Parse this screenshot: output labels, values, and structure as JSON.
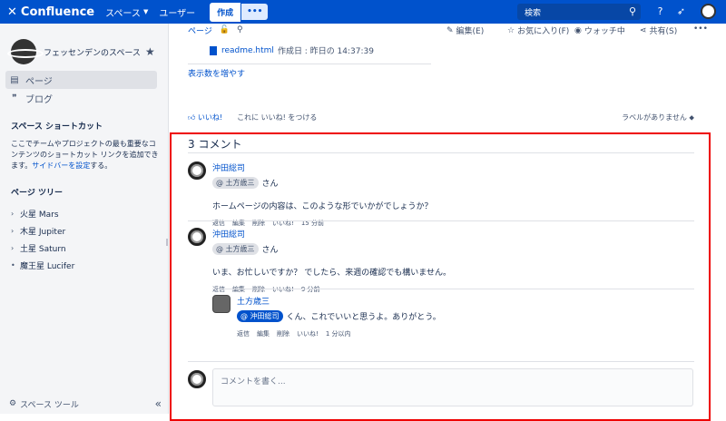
{
  "topnav": {
    "logo": "Confluence",
    "spaces": "スペース",
    "people": "ユーザー",
    "create": "作成",
    "more": "•••",
    "search_placeholder": "検索",
    "search_icon": "search-icon",
    "help_icon": "help-icon",
    "notifications_icon": "rocket-icon"
  },
  "sidebar": {
    "space_name": "フェッセンデンのスペース",
    "items": [
      {
        "label": "ページ",
        "icon": "page-icon"
      },
      {
        "label": "ブログ",
        "icon": "quote-icon"
      }
    ],
    "shortcuts_heading": "スペース ショートカット",
    "shortcuts_text": "ここでチームやプロジェクトの最も重要なコンテンツのショートカット リンクを追加できます。",
    "shortcuts_link": "サイドバーを設定",
    "shortcuts_tail": "する。",
    "tree_heading": "ページ ツリー",
    "tree": [
      {
        "label": "火星 Mars",
        "mark": "›"
      },
      {
        "label": "木星 Jupiter",
        "mark": "›"
      },
      {
        "label": "土星 Saturn",
        "mark": "›"
      },
      {
        "label": "魔王星 Lucifer",
        "mark": "•"
      }
    ],
    "footer": "スペース ツール",
    "collapse": "«"
  },
  "page": {
    "breadcrumb": "ページ",
    "actions": {
      "edit": "編集(E)",
      "favorite": "お気に入り(F)",
      "watch": "ウォッチ中",
      "share": "共有(S)",
      "more": "•••"
    },
    "attachment": "readme.html",
    "attachment_meta": "作成日 : 昨日の 14:37:39",
    "show_more": "表示数を増やす",
    "like": "いいね!",
    "like_prompt": "これに いいね! をつける",
    "labels": "ラベルがありません"
  },
  "comments": {
    "title": "3 コメント",
    "items": [
      {
        "author": "沖田総司",
        "mention": "@ 土方歳三",
        "mention_suffix": "さん",
        "text": "ホームページの内容は、このような形でいかがでしょうか？",
        "actions": [
          "返信",
          "編集",
          "削除",
          "いいね!",
          "15 分前"
        ]
      },
      {
        "author": "沖田総司",
        "mention": "@ 土方歳三",
        "mention_suffix": "さん",
        "text": "いま、お忙しいですか？ でしたら、来週の確認でも構いません。",
        "actions": [
          "返信",
          "編集",
          "削除",
          "いいね!",
          "9 分前"
        ]
      },
      {
        "author": "土方歳三",
        "mention": "@ 沖田総司",
        "mention_suffix": "くん、これでいいと思うよ。ありがとう。",
        "text": "",
        "actions": [
          "返信",
          "編集",
          "削除",
          "いいね!",
          "1 分以内"
        ]
      }
    ],
    "write_placeholder": "コメントを書く..."
  }
}
